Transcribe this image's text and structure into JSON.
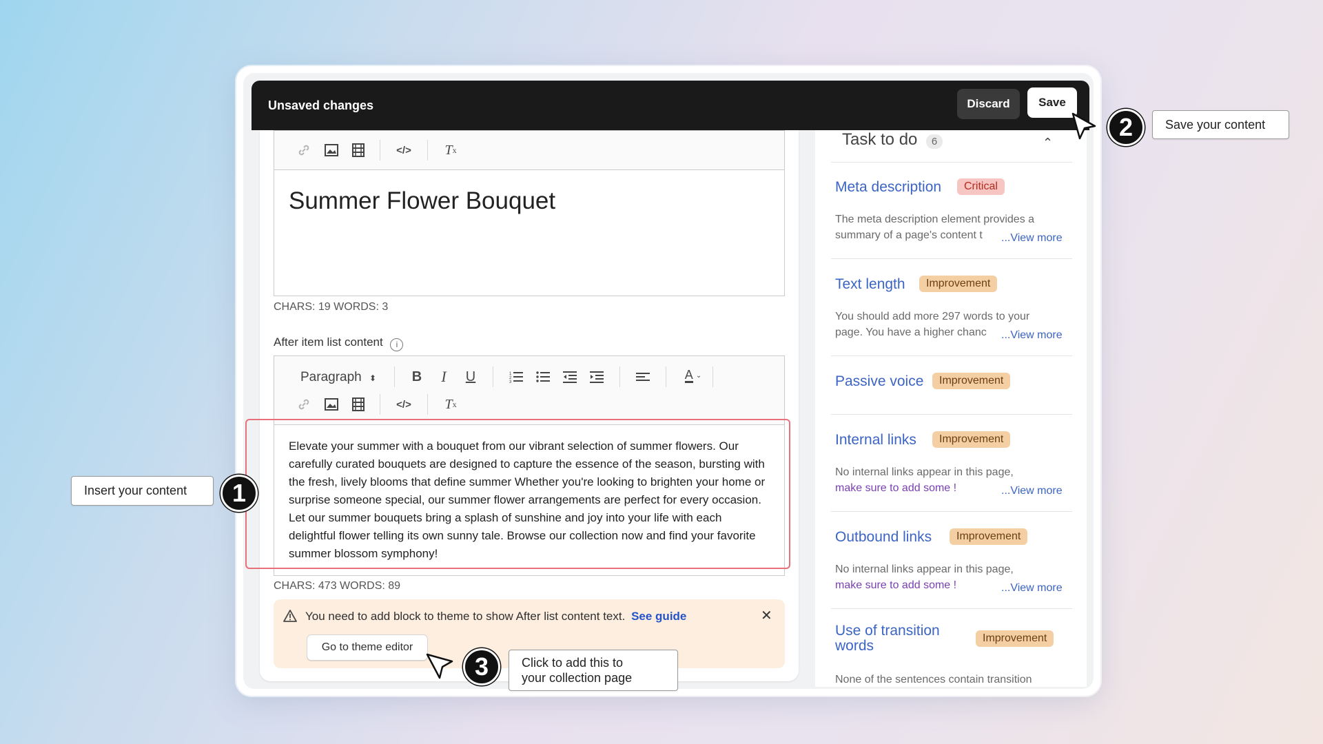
{
  "topbar": {
    "title": "Unsaved changes",
    "discard_label": "Discard",
    "save_label": "Save"
  },
  "editor1": {
    "title_text": "Summer Flower Bouquet",
    "stats": "CHARS: 19 WORDS: 3"
  },
  "editor2": {
    "label": "After item list content",
    "paragraph_select": "Paragraph",
    "body_text": "Elevate your summer with a bouquet from our vibrant selection of summer flowers. Our carefully curated bouquets are designed to capture the essence of the season, bursting with the fresh, lively blooms that define summer Whether you're looking to brighten your home or surprise someone special, our summer flower arrangements are perfect for every occasion. Let our summer bouquets bring a splash of sunshine and joy into your life with each delightful flower telling its own sunny tale. Browse our collection now and find your favorite summer blossom symphony!",
    "stats": "CHARS: 473 WORDS: 89"
  },
  "warning": {
    "text": "You need to add block to theme to show After list content text.",
    "link": "See guide",
    "button": "Go to theme editor"
  },
  "tasks": {
    "title": "Task to do",
    "count": "6",
    "items": [
      {
        "title": "Meta description",
        "badge": "Critical",
        "desc1": "The meta description element provides a",
        "desc2": "summary of a page's content t",
        "more": "...View more"
      },
      {
        "title": "Text length",
        "badge": "Improvement",
        "desc1": "You should add more 297 words to your",
        "desc2": "page. You have a higher chanc",
        "more": "...View more"
      },
      {
        "title": "Passive voice",
        "badge": "Improvement"
      },
      {
        "title": "Internal links",
        "badge": "Improvement",
        "desc1": "No internal links appear in this page,",
        "desc2": "make sure to add some !",
        "more": "...View more"
      },
      {
        "title": "Outbound links",
        "badge": "Improvement",
        "desc1": "No internal links appear in this page,",
        "desc2": "make sure to add some !",
        "more": "...View more"
      },
      {
        "title1": "Use of transition",
        "title2": "words",
        "badge": "Improvement",
        "desc1": "None of the sentences contain transition"
      }
    ]
  },
  "callouts": {
    "c1": {
      "num": "1",
      "text": "Insert your content"
    },
    "c2": {
      "num": "2",
      "text": "Save your content"
    },
    "c3": {
      "num": "3",
      "line1": "Click to add this to",
      "line2": "your collection page"
    }
  },
  "colors": {
    "accent_blue": "#3b64c4",
    "critical_bg": "#f8c6c2",
    "improvement_bg": "#f5cfa4",
    "highlight_red": "#e8707a",
    "topbar_bg": "#1a1a1a"
  }
}
